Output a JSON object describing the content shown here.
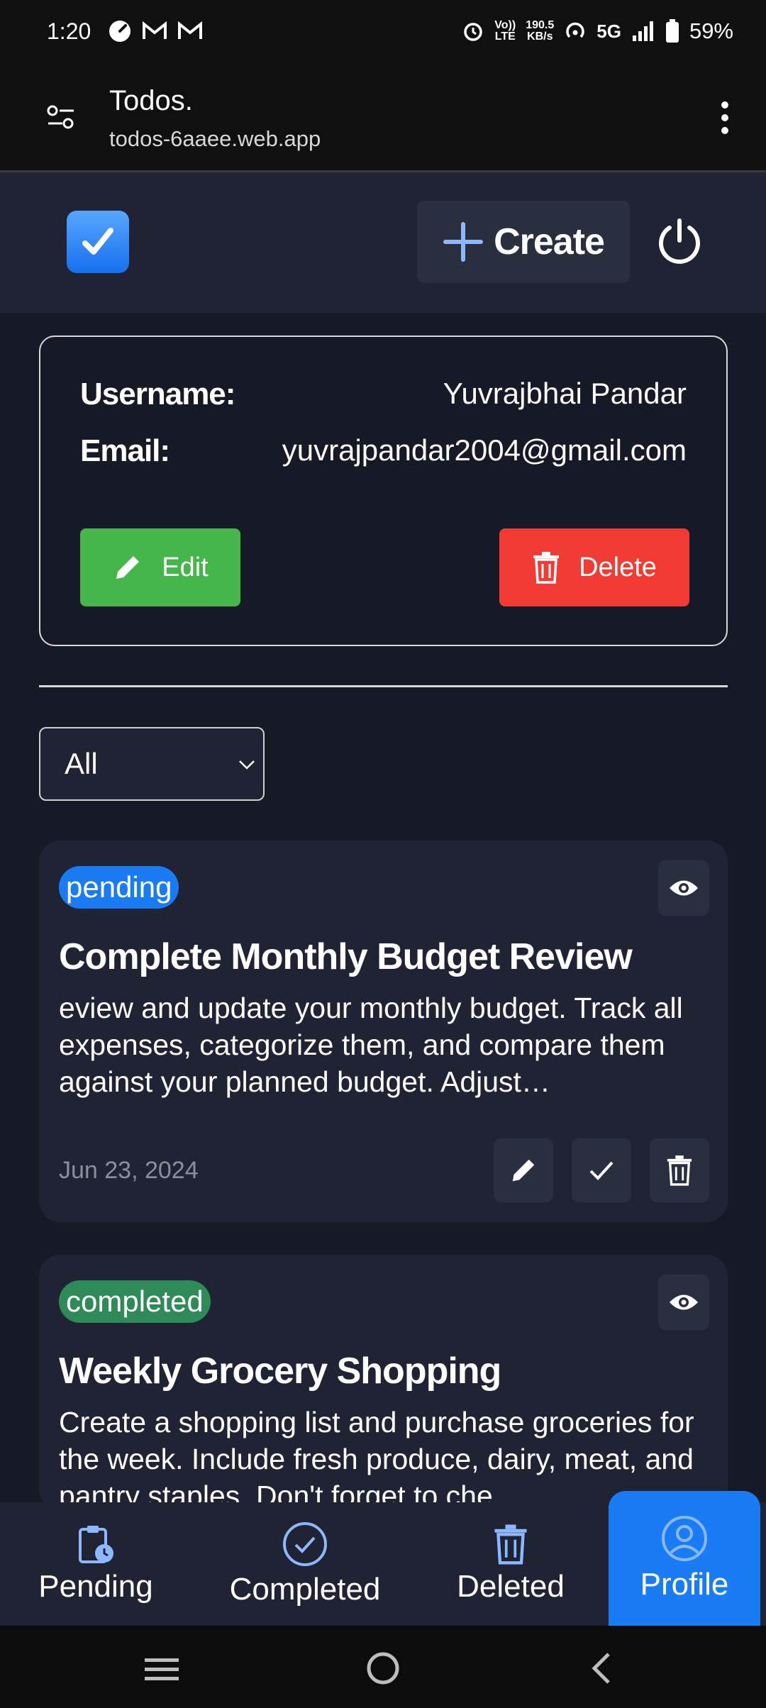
{
  "status_bar": {
    "time": "1:20",
    "speed_value": "190.5",
    "speed_unit": "KB/s",
    "volte_top": "Vo))",
    "volte_bottom": "LTE",
    "network": "5G",
    "battery": "59%"
  },
  "browser": {
    "title": "Todos.",
    "url": "todos-6aaee.web.app"
  },
  "header": {
    "create_label": "Create"
  },
  "profile": {
    "username_label": "Username:",
    "username_value": "Yuvrajbhai Pandar",
    "email_label": "Email:",
    "email_value": "yuvrajpandar2004@gmail.com",
    "edit_label": "Edit",
    "delete_label": "Delete"
  },
  "filter": {
    "selected": "All"
  },
  "todos": [
    {
      "status": "pending",
      "status_color": "#1a7cf5",
      "title": "Complete Monthly Budget Review",
      "description": "eview and update your monthly budget. Track all expenses, categorize them, and compare them against your planned budget. Adjust…",
      "date": "Jun 23, 2024"
    },
    {
      "status": "completed",
      "status_color": "#2e8b57",
      "title": "Weekly Grocery Shopping",
      "description": "Create a shopping list and purchase groceries for the week. Include fresh produce, dairy, meat, and pantry staples. Don't forget to che"
    }
  ],
  "nav": {
    "pending": "Pending",
    "completed": "Completed",
    "deleted": "Deleted",
    "profile": "Profile",
    "active": "Profile"
  },
  "colors": {
    "background": "#161a27",
    "card": "#1f2333",
    "accent": "#1a7cf5",
    "edit": "#45b649",
    "delete": "#f23b32"
  }
}
